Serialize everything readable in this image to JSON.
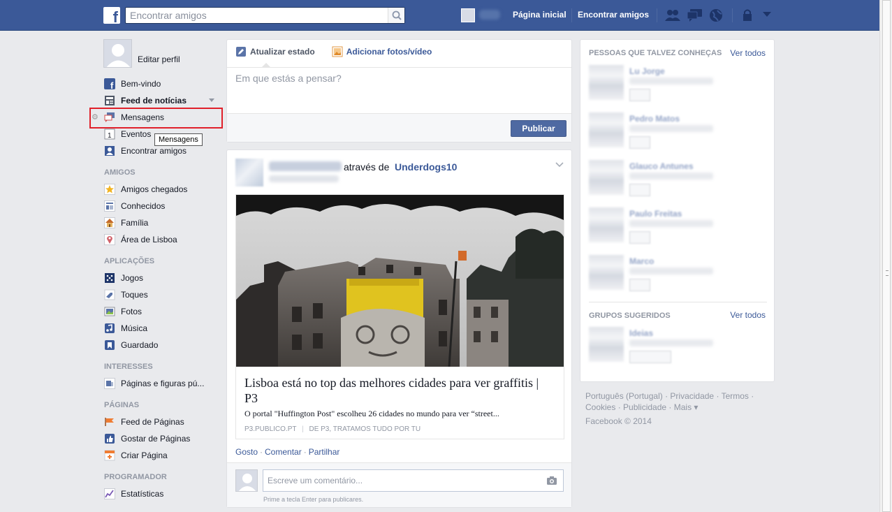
{
  "topbar": {
    "search_placeholder": "Encontrar amigos",
    "home_label": "Página inicial",
    "find_friends_label": "Encontrar amigos"
  },
  "profile": {
    "edit_label": "Editar perfil"
  },
  "nav": {
    "favorites": [
      {
        "label": "Bem-vindo",
        "icon": "facebook-icon"
      },
      {
        "label": "Feed de notícias",
        "icon": "news-feed-icon"
      },
      {
        "label": "Mensagens",
        "icon": "messages-icon"
      },
      {
        "label": "Eventos",
        "icon": "calendar-icon"
      },
      {
        "label": "Encontrar amigos",
        "icon": "find-friends-icon"
      }
    ],
    "friends_heading": "AMIGOS",
    "friends": [
      {
        "label": "Amigos chegados",
        "icon": "star-icon"
      },
      {
        "label": "Conhecidos",
        "icon": "list-icon"
      },
      {
        "label": "Família",
        "icon": "house-icon"
      },
      {
        "label": "Área de Lisboa",
        "icon": "location-icon"
      }
    ],
    "apps_heading": "APLICAÇÕES",
    "apps": [
      {
        "label": "Jogos",
        "icon": "games-icon"
      },
      {
        "label": "Toques",
        "icon": "poke-icon"
      },
      {
        "label": "Fotos",
        "icon": "photos-icon"
      },
      {
        "label": "Música",
        "icon": "music-icon"
      },
      {
        "label": "Guardado",
        "icon": "bookmark-icon"
      }
    ],
    "interests_heading": "INTERESSES",
    "interests": [
      {
        "label": "Páginas e figuras pú...",
        "icon": "rss-icon"
      }
    ],
    "pages_heading": "PÁGINAS",
    "pages": [
      {
        "label": "Feed de Páginas",
        "icon": "flag-icon"
      },
      {
        "label": "Gostar de Páginas",
        "icon": "like-icon"
      },
      {
        "label": "Criar Página",
        "icon": "create-page-icon"
      }
    ],
    "dev_heading": "PROGRAMADOR",
    "dev": [
      {
        "label": "Estatísticas",
        "icon": "insights-icon"
      }
    ],
    "tooltip": "Mensagens",
    "event_count": "1"
  },
  "composer": {
    "tab_status": "Atualizar estado",
    "tab_photos": "Adicionar fotos/vídeo",
    "placeholder": "Em que estás a pensar?",
    "publish_label": "Publicar"
  },
  "post": {
    "via_text": "através de",
    "page_name": "Underdogs10",
    "link_title": "Lisboa está no top das melhores cidades para ver graffitis | P3",
    "link_description": "O portal \"Huffington Post\" escolheu 26 cidades no mundo para ver “street...",
    "link_source": "P3.PUBLICO.PT",
    "link_source_sep": "|",
    "link_source_tagline": "DE P3, TRATAMOS TUDO POR TU",
    "actions": [
      "Gosto",
      "Comentar",
      "Partilhar"
    ],
    "comment_placeholder": "Escreve um comentário...",
    "comment_hint": "Prime a tecla Enter para publicares."
  },
  "right": {
    "people_heading": "PESSOAS QUE TALVEZ CONHEÇAS",
    "see_all": "Ver todos",
    "groups_heading": "GRUPOS SUGERIDOS"
  },
  "footer": {
    "links": [
      "Português (Portugal)",
      "Privacidade",
      "Termos",
      "Cookies",
      "Publicidade",
      "Mais"
    ],
    "copyright": "Facebook © 2014"
  },
  "colors": {
    "brand": "#3b5998",
    "highlight": "#e0202a"
  }
}
